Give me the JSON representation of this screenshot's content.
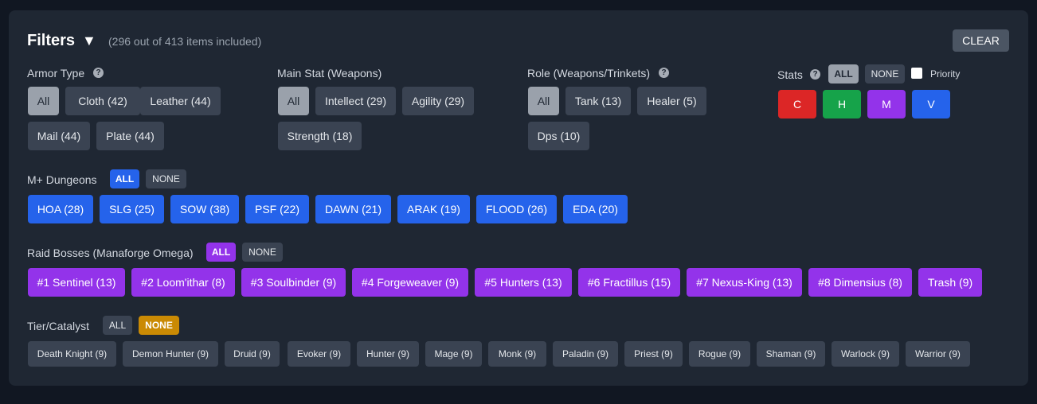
{
  "header": {
    "title": "Filters",
    "caret": "▼",
    "summary": "(296 out of 413 items included)",
    "clear_label": "CLEAR"
  },
  "armor": {
    "label": "Armor Type",
    "help": "?",
    "options": [
      "All",
      "Cloth (42)",
      "Leather (44)",
      "Mail (44)",
      "Plate (44)"
    ],
    "selected": "All"
  },
  "main_stat": {
    "label": "Main Stat (Weapons)",
    "options": [
      "All",
      "Intellect (29)",
      "Agility (29)",
      "Strength (18)"
    ],
    "selected": "All"
  },
  "role": {
    "label": "Role (Weapons/Trinkets)",
    "help": "?",
    "options": [
      "All",
      "Tank (13)",
      "Healer (5)",
      "Dps (10)"
    ],
    "selected": "All"
  },
  "stats": {
    "label": "Stats",
    "help": "?",
    "all_label": "ALL",
    "none_label": "NONE",
    "priority_label": "Priority",
    "priority_checked": false,
    "buttons": [
      "C",
      "H",
      "M",
      "V"
    ]
  },
  "dungeons": {
    "label": "M+ Dungeons",
    "all_label": "ALL",
    "none_label": "NONE",
    "items": [
      "HOA (28)",
      "SLG (25)",
      "SOW (38)",
      "PSF (22)",
      "DAWN (21)",
      "ARAK (19)",
      "FLOOD (26)",
      "EDA (20)"
    ]
  },
  "raid": {
    "label": "Raid Bosses (Manaforge Omega)",
    "all_label": "ALL",
    "none_label": "NONE",
    "items": [
      "#1 Sentinel (13)",
      "#2 Loom'ithar (8)",
      "#3 Soulbinder (9)",
      "#4 Forgeweaver (9)",
      "#5 Hunters (13)",
      "#6 Fractillus (15)",
      "#7 Nexus-King (13)",
      "#8 Dimensius (8)",
      "Trash (9)"
    ]
  },
  "tier": {
    "label": "Tier/Catalyst",
    "all_label": "ALL",
    "none_label": "NONE",
    "items": [
      "Death Knight (9)",
      "Demon Hunter (9)",
      "Druid (9)",
      "Evoker (9)",
      "Hunter (9)",
      "Mage (9)",
      "Monk (9)",
      "Paladin (9)",
      "Priest (9)",
      "Rogue (9)",
      "Shaman (9)",
      "Warlock (9)",
      "Warrior (9)"
    ]
  },
  "colors": {
    "panel": "#1f2733",
    "background": "#111722",
    "dungeon_blue": "#2563eb",
    "raid_purple": "#9333ea",
    "tier_none_gold": "#ca8a04"
  }
}
